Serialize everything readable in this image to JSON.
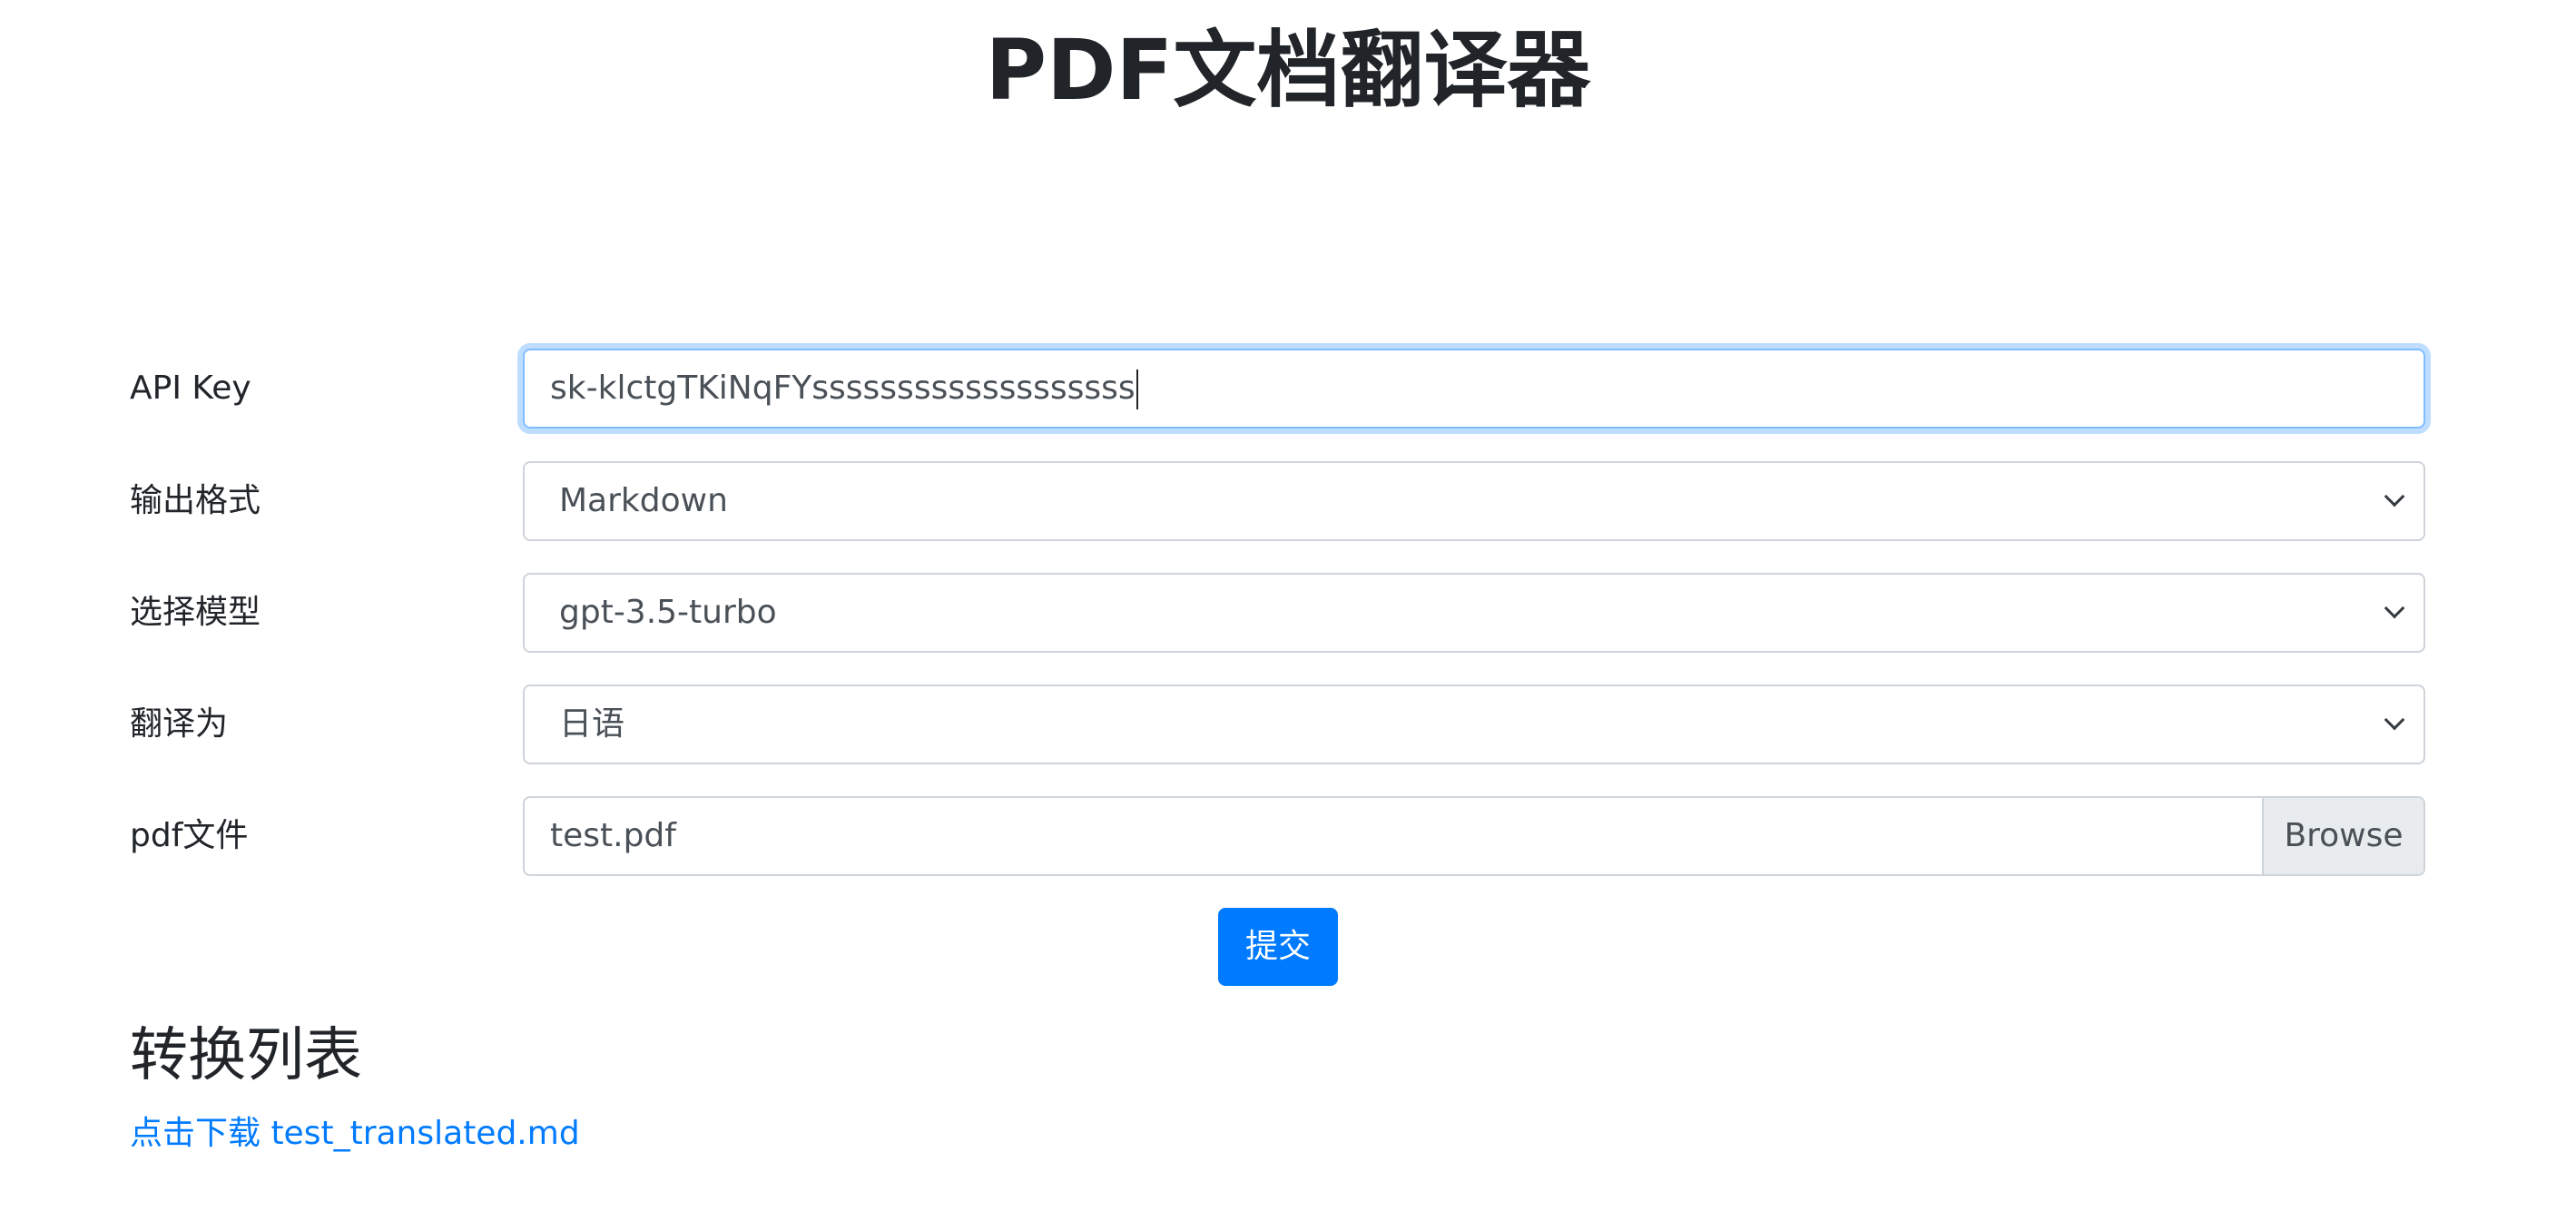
{
  "page": {
    "title": "PDF文档翻译器"
  },
  "form": {
    "api_key": {
      "label": "API Key",
      "value": "sk-klctgTKiNqFYsssssssssssssssssss"
    },
    "output_format": {
      "label": "输出格式",
      "selected": "Markdown"
    },
    "model": {
      "label": "选择模型",
      "selected": "gpt-3.5-turbo"
    },
    "target_language": {
      "label": "翻译为",
      "selected": "日语"
    },
    "pdf_file": {
      "label": "pdf文件",
      "file_name": "test.pdf",
      "browse_label": "Browse"
    },
    "submit_label": "提交"
  },
  "conversions": {
    "title": "转换列表",
    "items": [
      {
        "link_text": "点击下载 test_translated.md"
      }
    ]
  },
  "colors": {
    "primary": "#007bff",
    "focus_border": "#80bdff",
    "input_border": "#ced4da",
    "browse_bg": "#e9ecef"
  }
}
